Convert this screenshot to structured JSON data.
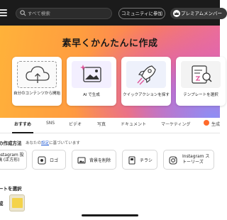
{
  "topbar": {
    "search_placeholder": "すべて検索",
    "community_label": "コミュニティに参加",
    "premium_label": "プレミアムメンバー"
  },
  "hero": {
    "title": "素早くかんたんに作成",
    "cards": [
      {
        "label": "自分のコンテンツから開始"
      },
      {
        "label": "AI で生成"
      },
      {
        "label": "クイックアクションを探す"
      },
      {
        "label": "テンプレートを選択"
      }
    ]
  },
  "tabs": [
    {
      "label": "おすすめ"
    },
    {
      "label": "SNS"
    },
    {
      "label": "ビデオ"
    },
    {
      "label": "写真"
    },
    {
      "label": "ドキュメント"
    },
    {
      "label": "マーケティング"
    },
    {
      "label": "生成"
    }
  ],
  "section1": {
    "title": "の作成方法",
    "sub_prefix": "あなたの",
    "sub_link": "設定",
    "sub_suffix": "に基づいています",
    "items": [
      {
        "label": "nstagram 投稿 (正方形)"
      },
      {
        "label": "ロゴ"
      },
      {
        "label": "背景を削除"
      },
      {
        "label": "チラシ"
      },
      {
        "label": "Instagram ストーリーズ"
      }
    ]
  },
  "section2": {
    "title": "ートを選択",
    "recent_label": "成"
  },
  "colors": {
    "accent_orange": "#ff9d3f",
    "accent_pink": "#d55fc3",
    "link_blue": "#2c64d8"
  }
}
